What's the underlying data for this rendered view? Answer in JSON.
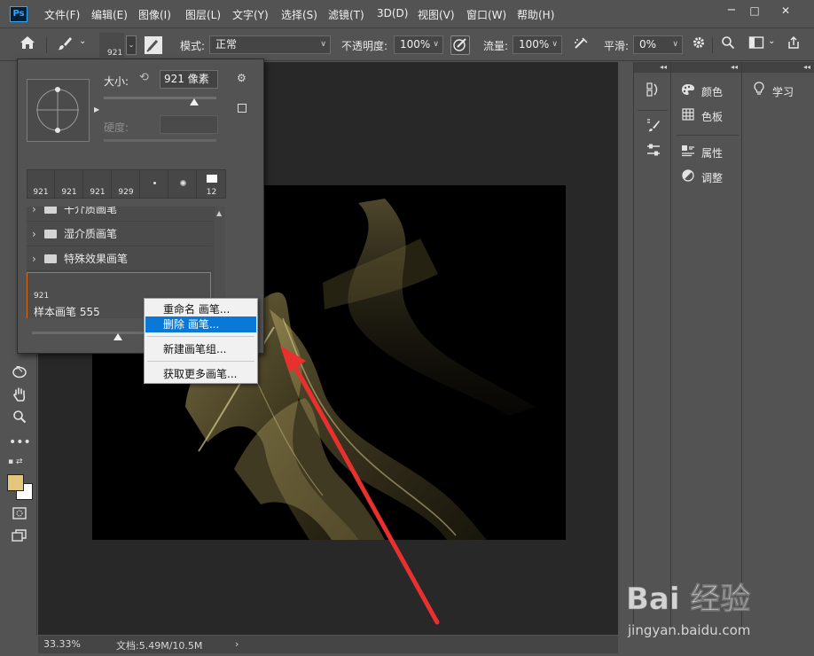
{
  "app": {
    "logo_text": "Ps"
  },
  "menubar": {
    "items": [
      "文件(F)",
      "编辑(E)",
      "图像(I)",
      "图层(L)",
      "文字(Y)",
      "选择(S)",
      "滤镜(T)",
      "3D(D)",
      "视图(V)",
      "窗口(W)",
      "帮助(H)"
    ]
  },
  "window_controls": {
    "minimize": "−",
    "maximize": "□",
    "close": "✕"
  },
  "options_bar": {
    "brush_size": "921",
    "mode_label": "模式:",
    "mode_value": "正常",
    "opacity_label": "不透明度:",
    "opacity_value": "100%",
    "flow_label": "流量:",
    "flow_value": "100%",
    "smoothing_label": "平滑:",
    "smoothing_value": "0%"
  },
  "brush_panel": {
    "size_label": "大小:",
    "size_value": "921 像素",
    "hardness_label": "硬度:",
    "size_slider_level": 0.8,
    "recent_brushes": [
      "921",
      "921",
      "921",
      "929",
      "",
      "",
      "12"
    ],
    "groups": [
      "干介质画笔",
      "湿介质画笔",
      "特殊效果画笔"
    ],
    "selected_brush": {
      "size": "921",
      "name": "样本画笔  555"
    },
    "preview_slider_level": 0.4
  },
  "context_menu": {
    "items": [
      "重命名 画笔...",
      "删除 画笔...",
      "新建画笔组...",
      "获取更多画笔..."
    ],
    "active_index": 1
  },
  "right_panels": {
    "col2": [
      {
        "icon": "palette-icon",
        "label": "颜色"
      },
      {
        "icon": "grid-icon",
        "label": "色板"
      },
      {
        "icon": "properties-icon",
        "label": "属性"
      },
      {
        "icon": "adjust-icon",
        "label": "调整"
      }
    ],
    "col3": [
      {
        "icon": "bulb-icon",
        "label": "学习"
      }
    ]
  },
  "status": {
    "zoom": "33.33%",
    "doc": "文档:5.49M/10.5M"
  },
  "colors": {
    "accent": "#0a78d7",
    "selection_border": "#d06a20",
    "foreground": "#e3c77c",
    "background": "#ffffff",
    "arrow": "#e8312f",
    "smoke": "#c6b36b"
  },
  "watermark": {
    "text": "Bai 经验",
    "url": "jingyan.baidu.com"
  }
}
